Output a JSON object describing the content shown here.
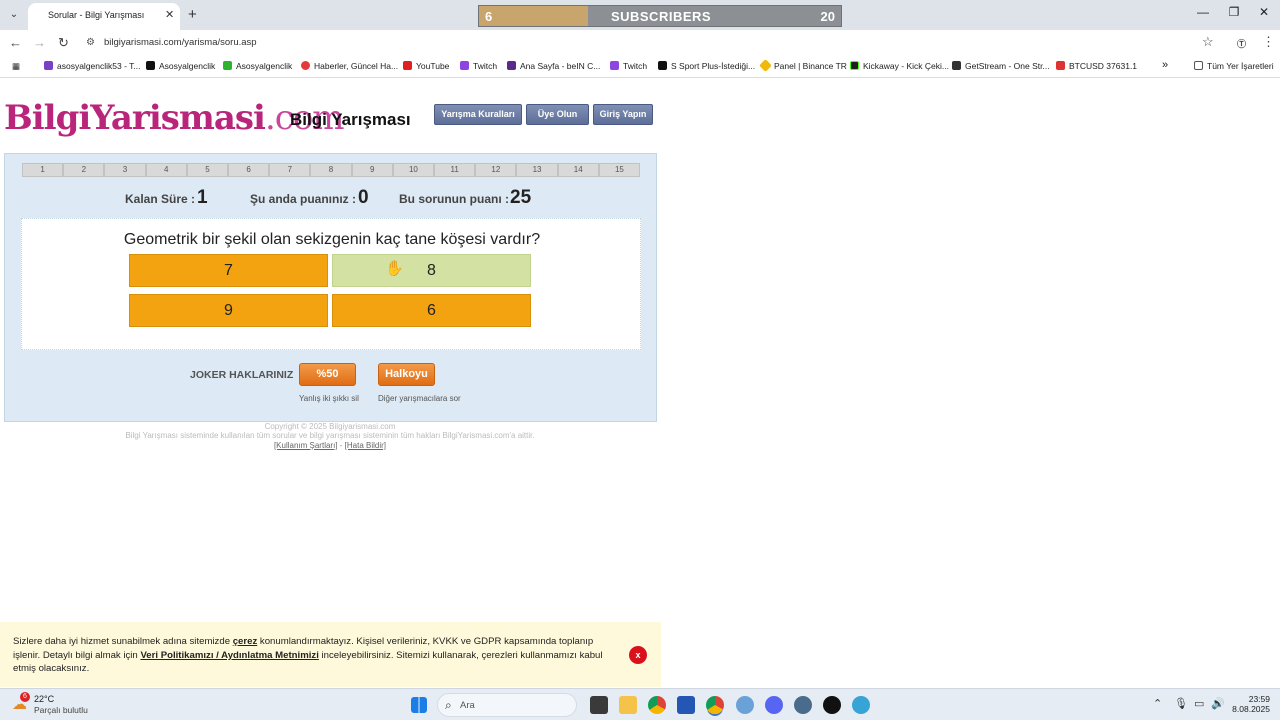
{
  "browser": {
    "tab_title": "Sorular - Bilgi Yarışması",
    "url": "bilgiyarismasi.com/yarisma/soru.asp",
    "bookmarks": [
      "asosyalgenclik53 - T...",
      "Asosyalgenclik",
      "Asosyalgenclik",
      "Haberler, Güncel Ha...",
      "YouTube",
      "Twitch",
      "Ana Sayfa - beIN C...",
      "Twitch",
      "S Sport Plus-İstediği...",
      "Panel | Binance TR",
      "Kickaway - Kick Çeki...",
      "GetStream - One Str...",
      "BTCUSD 37631.1"
    ],
    "all_bookmarks": "Tüm Yer İşaretleri",
    "bookmark_overflow": "»"
  },
  "overlay": {
    "left_count": "6",
    "label": "SUBSCRIBERS",
    "right_count": "20",
    "progress": 0.3
  },
  "site": {
    "logo_part1": "Bilgi",
    "logo_part2": "Yarismasi",
    "logo_part3": ".com",
    "title": "Bilgi Yarışması",
    "nav": [
      "Yarışma Kuralları",
      "Üye Olun",
      "Giriş Yapın"
    ]
  },
  "quiz": {
    "question_numbers": [
      "1",
      "2",
      "3",
      "4",
      "5",
      "6",
      "7",
      "8",
      "9",
      "10",
      "11",
      "12",
      "13",
      "14",
      "15"
    ],
    "remaining_label": "Kalan Süre :",
    "remaining_value": "1",
    "score_label": "Şu anda puanınız :",
    "score_value": "0",
    "points_label": "Bu sorunun puanı :",
    "points_value": "25",
    "question": "Geometrik bir şekil olan sekizgenin kaç tane köşesi vardır?",
    "answers": [
      "7",
      "8",
      "9",
      "6"
    ],
    "selected_answer": "8",
    "joker_label": "JOKER HAKLARINIZ",
    "joker_50": "%50",
    "joker_50_caption": "Yanlış iki şıkkı sil",
    "joker_audience": "Halkoyu",
    "joker_audience_caption": "Diğer yarışmacılara sor"
  },
  "footer": {
    "copyright": "Copyright © 2025 Bilgiyarismasi.com",
    "rights": "Bilgi Yarışması sisteminde kullanılan tüm sorular ve bilgi yarışması sisteminin tüm hakları BilgiYarismasi.com'a aittir.",
    "terms": "[Kullanım Şartları]",
    "separator": "-",
    "report": "[Hata Bildir]"
  },
  "cookie": {
    "text_1": "Sizlere daha iyi hizmet sunabilmek adına sitemizde ",
    "cerez": "çerez",
    "text_2": " konumlandırmaktayız. Kişisel verileriniz, KVKK ve GDPR kapsamında toplanıp işlenir. Detaylı bilgi almak için ",
    "policy": "Veri Politikamızı / Aydınlatma Metnimizi",
    "text_3": " inceleyebilirsiniz. Sitemizi kullanarak, çerezleri kullanmamızı kabul etmiş olacaksınız.",
    "close": "x"
  },
  "taskbar": {
    "weather_badge": "6",
    "temp": "22°C",
    "weather_desc": "Parçalı bulutlu",
    "search_placeholder": "Ara",
    "time": "23:59",
    "date": "8.08.2025"
  }
}
